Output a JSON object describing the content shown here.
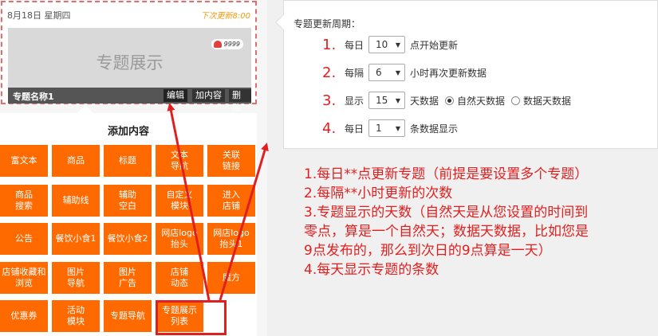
{
  "preview": {
    "date": "8月18日 星期四",
    "next_update": "下次更新8:00",
    "title": "专题展示",
    "badge_count": "9999",
    "caption_name": "专题名称1",
    "buttons": {
      "edit": "编辑",
      "add_content": "加内容",
      "delete": "删除"
    }
  },
  "add_panel": {
    "title": "添加内容",
    "tiles": [
      {
        "label": "富文本"
      },
      {
        "label": "商品"
      },
      {
        "label": "标题"
      },
      {
        "label": "文本\n导航"
      },
      {
        "label": "关联\n链接"
      },
      {
        "label": "商品\n搜索"
      },
      {
        "label": "辅助线"
      },
      {
        "label": "辅助\n空白"
      },
      {
        "label": "自定义\n模块"
      },
      {
        "label": "进入\n店铺"
      },
      {
        "label": "公告"
      },
      {
        "label": "餐饮小食1"
      },
      {
        "label": "餐饮小食2"
      },
      {
        "label": "网店logo\n抬头"
      },
      {
        "label": "网店logo\n抬头1"
      },
      {
        "label": "店铺收藏和\n浏览"
      },
      {
        "label": "图片\n导航"
      },
      {
        "label": "图片\n广告"
      },
      {
        "label": "店铺\n动态"
      },
      {
        "label": "魔方"
      },
      {
        "label": "优惠券"
      },
      {
        "label": "活动\n模块"
      },
      {
        "label": "专题导航"
      },
      {
        "label": "专题展示\n列表"
      }
    ]
  },
  "settings": {
    "title": "专题更新周期：",
    "rows": [
      {
        "num": "1.",
        "pre": "每日",
        "value": "10",
        "post": "点开始更新"
      },
      {
        "num": "2.",
        "pre": "每隔",
        "value": "6",
        "post": "小时再次更新数据"
      },
      {
        "num": "3.",
        "pre": "显示",
        "value": "15",
        "post": "天数据"
      },
      {
        "num": "4.",
        "pre": "每日",
        "value": "1",
        "post": "条数据显示"
      }
    ],
    "radio_natural": "自然天数据",
    "radio_data": "数据天数据",
    "radio_selected": "natural"
  },
  "notes": [
    "1.每日**点更新专题（前提是要设置多个专题）",
    "2.每隔**小时更新的次数",
    "3.专题显示的天数（自然天是从您设置的时间到",
    "零点，算是一个自然天；数据天数据，比如您是",
    "9点发布的，那么到次日的9点算是一天）",
    "4.每天显示专题的条数"
  ],
  "colors": {
    "tile": "#ff6a00",
    "annotation_red": "#e02020",
    "next_update": "#f39c12"
  }
}
